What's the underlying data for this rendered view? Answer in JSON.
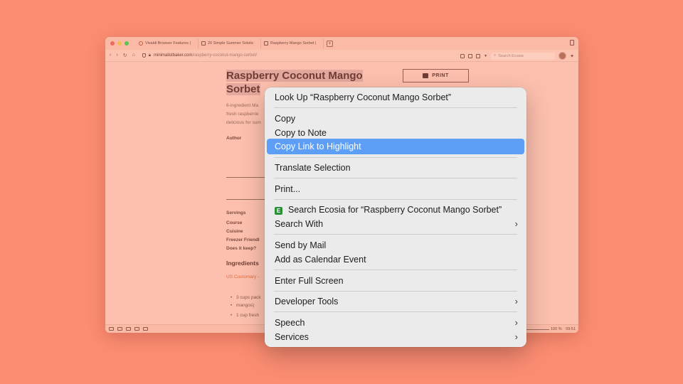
{
  "tabs": [
    {
      "label": "Vivaldi Browser Features |"
    },
    {
      "label": "20 Simple Summer Solstic"
    },
    {
      "label": "Raspberry Mango Sorbet |"
    }
  ],
  "address": {
    "host": "minimalistbaker.com",
    "path": "/raspberry-coconut-mango-sorbet/"
  },
  "search": {
    "placeholder": "Search Ecosia"
  },
  "page": {
    "title_line1": "Raspberry Coconut Mango",
    "title_line2": "Sorbet",
    "print_label": "PRINT",
    "desc_lines": [
      "6-ingredient Ma",
      "fresh raspberrie",
      "delicious for sum"
    ],
    "author_label": "Author",
    "meta": [
      "Servings",
      "Course",
      "Cuisine",
      "Freezer Friendl",
      "Does it keep?"
    ],
    "ingredients_heading": "Ingredients",
    "us_customary": "US Customary -",
    "ingredients": [
      "3 cups pack",
      "mangos)",
      "1 cup fresh"
    ]
  },
  "status": {
    "zoom": "100 %",
    "clock": "09:51"
  },
  "menu": {
    "look_up": "Look Up “Raspberry Coconut Mango Sorbet”",
    "copy": "Copy",
    "copy_to_note": "Copy to Note",
    "copy_link_to_highlight": "Copy Link to Highlight",
    "translate_selection": "Translate Selection",
    "print": "Print...",
    "search_ecosia": "Search Ecosia for “Raspberry Coconut Mango Sorbet”",
    "search_with": "Search With",
    "send_by_mail": "Send by Mail",
    "add_calendar_event": "Add as Calendar Event",
    "enter_full_screen": "Enter Full Screen",
    "developer_tools": "Developer Tools",
    "speech": "Speech",
    "services": "Services"
  },
  "colors": {
    "background": "#fc8d73",
    "menu_highlight": "#5d9ff7",
    "ecosia_green": "#2d8f3a"
  }
}
